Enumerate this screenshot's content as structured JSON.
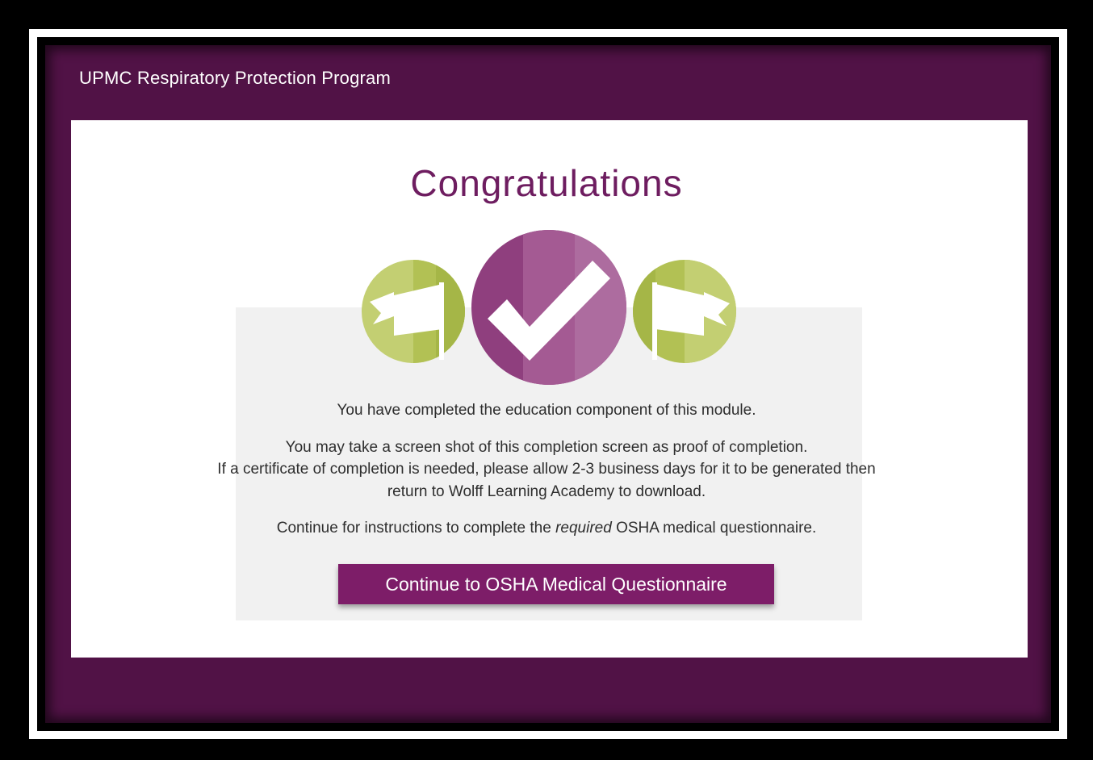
{
  "header": {
    "title": "UPMC Respiratory Protection Program"
  },
  "main": {
    "heading": "Congratulations",
    "line1": "You have completed the education component of this module.",
    "line2": "You may take a screen shot of this completion screen as proof of completion.",
    "line3": "If a certificate of completion is needed, please allow 2-3 business days for it to be generated then",
    "line4": "return to Wolff Learning Academy to download.",
    "line5_prefix": "Continue for instructions to complete the",
    "line5_emphasis": "required",
    "line5_suffix": "OSHA medical questionnaire.",
    "button_label": "Continue to OSHA Medical Questionnaire"
  },
  "icons": {
    "left_badge": "flag-icon",
    "center_badge": "checkmark-icon",
    "right_badge": "flag-icon"
  },
  "colors": {
    "brand_purple": "#511246",
    "heading_purple": "#6e1d60",
    "button_purple": "#7d1d68",
    "badge_green": "#b3c25a",
    "badge_purple": "#9b4f8b"
  }
}
